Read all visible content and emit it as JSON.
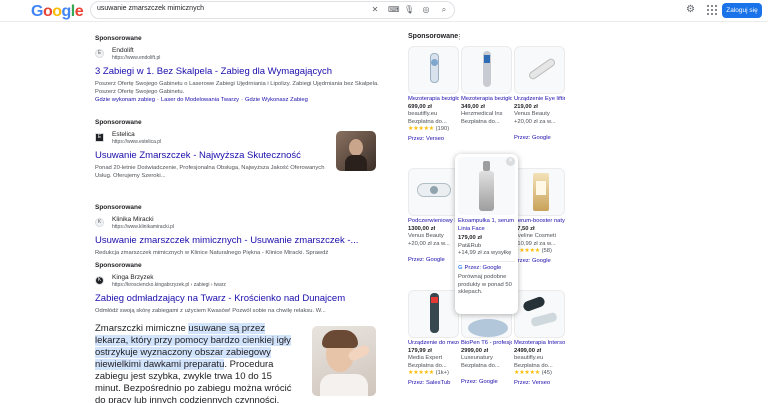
{
  "header": {
    "logo": [
      "G",
      "o",
      "o",
      "g",
      "l",
      "e"
    ],
    "logo_colors": [
      "#4285f4",
      "#ea4335",
      "#fbbc05",
      "#4285f4",
      "#34a853",
      "#ea4335"
    ],
    "query": "usuwanie zmarszczek mimicznych",
    "login_label": "Zaloguj się"
  },
  "ads": [
    {
      "sponsored": "Sponsorowane",
      "favicon": "E",
      "advertiser": "Endolift",
      "url": "https://www.endolift.pl",
      "title": "3 Zabiegi w 1. Bez Skalpela - Zabieg dla Wymagających",
      "desc": "Poszerz Ofertę Swojego Gabinetu o Laserowe Zabiegi Ujędrniania i Lipolizy. Zabiegi Ujędrniania bez Skalpela. Poszerz Ofertę Swojego Gabinetu.",
      "sitelinks": [
        "Gdzie wykonam zabieg",
        "·",
        "Laser do Modelowania Twarzy",
        "·",
        "Gdzie Wykonasz Zabieg"
      ]
    },
    {
      "sponsored": "Sponsorowane",
      "favicon": "E",
      "advertiser": "Estelica",
      "url": "https://www.estelica.pl",
      "title": "Usuwanie Zmarszczek - Najwyższa Skuteczność",
      "desc": "Ponad 20-letnie Doświadczenie, Profesjonalna Obsługa, Najwyższa Jakość Oferowanych Usług. Oferujemy Szeroki..."
    },
    {
      "sponsored": "Sponsorowane",
      "favicon": "K",
      "advertiser": "Klinika Miracki",
      "url": "https://www.klinikamiracki.pl",
      "title": "Usuwanie zmarszczek mimicznych - Usuwanie zmarszczek -...",
      "desc": "Redukcja zmarszczek mimicznych w Klinice Naturalnego Piękna - Klinice Miracki. Sprawdź"
    },
    {
      "sponsored": "Sponsorowane",
      "favicon": "K",
      "advertiser": "Kinga Brzyzek",
      "url": "https://krosciencko.kingabrzyzek.pl › zabiegi › twarz",
      "title": "Zabieg odmładzający na Twarz - Krościenko nad Dunajcem",
      "desc": "Odmłódź swoją skórę zabiegami z użyciem Kwasów! Pozwól sobie na chwilę relaksu. W..."
    }
  ],
  "snippet": {
    "pre": "Zmarszczki mimiczne ",
    "highlight": "usuwane są przez lekarza, który przy pomocy bardzo cienkiej igły ostrzykuje wyznaczony obszar zabiegowy niewielkimi dawkami preparatu",
    "post": ". Procedura zabiegu jest szybka, zwykle trwa 10 do 15 minut. Bezpośrednio po zabiegu można wrócić do pracy lub innych codziennych czynności."
  },
  "shopping": {
    "heading": "Sponsorowane",
    "cards": [
      {
        "title": "Mezoterapia bezigłowa 8-...",
        "price": "699,00 zł",
        "seller": "beautifly.eu",
        "ship": "Bezpłatna do...",
        "rating": "★★★★★",
        "reviews": "(190)",
        "by": "Przez: Verseo"
      },
      {
        "title": "Mezoterapia bezigłowa 6 w...",
        "price": "349,00 zł",
        "seller": "Herzmedical Ins",
        "ship": "Bezpłatna do...",
        "rating": "",
        "reviews": "",
        "by": "Przez: Google"
      },
      {
        "title": "Urządzenie Eye lifting HOME...",
        "price": "219,00 zł",
        "seller": "Venus Beauty",
        "ship": "+20,00 zł za w...",
        "rating": "",
        "reviews": "",
        "by": "Przez: Google"
      },
      {
        "title": "Podczerwieniowy Lifting Twarzy",
        "price": "1300,00 zł",
        "seller": "Venus Beauty",
        "ship": "+20,00 zł za w...",
        "rating": "",
        "reviews": "",
        "by": "Przez: Google"
      },
      {
        "title": "Serum-booster natychmiasto...",
        "price": "37,50 zł",
        "seller": "Eveline Cosmeti",
        "ship": "+10,99 zł za w...",
        "rating": "★★★★★",
        "reviews": "(58)",
        "by": "Przez: Google"
      },
      {
        "title": "Urządzenie do mezoterapii 0...",
        "price": "179,99 zł",
        "seller": "Media Expert",
        "ship": "Bezpłatna do...",
        "rating": "★★★★★",
        "reviews": "(1k+)",
        "by": "Przez: SalesTub"
      },
      {
        "title": "BioPen T6 - profesjonalne...",
        "price": "2999,00 zł",
        "seller": "Luxeunatury",
        "ship": "Bezpłatna do...",
        "rating": "",
        "reviews": "",
        "by": "Przez: Google"
      },
      {
        "title": "Mezoterapia Interso Aura...",
        "price": "2499,00 zł",
        "seller": "beautifly.eu",
        "ship": "Bezpłatna do...",
        "rating": "★★★★★",
        "reviews": "(45)",
        "by": "Przez: Verseo"
      }
    ],
    "popup": {
      "title": "Ekoampułka 1, serum Linia Face",
      "price": "179,00 zł",
      "seller": "Pat&Rub",
      "ship": "+14,99 zł za wysyłkę",
      "g": "G",
      "by": "Przez: Google",
      "desc": "Porównaj podobne produkty w ponad 50 sklepach."
    }
  }
}
